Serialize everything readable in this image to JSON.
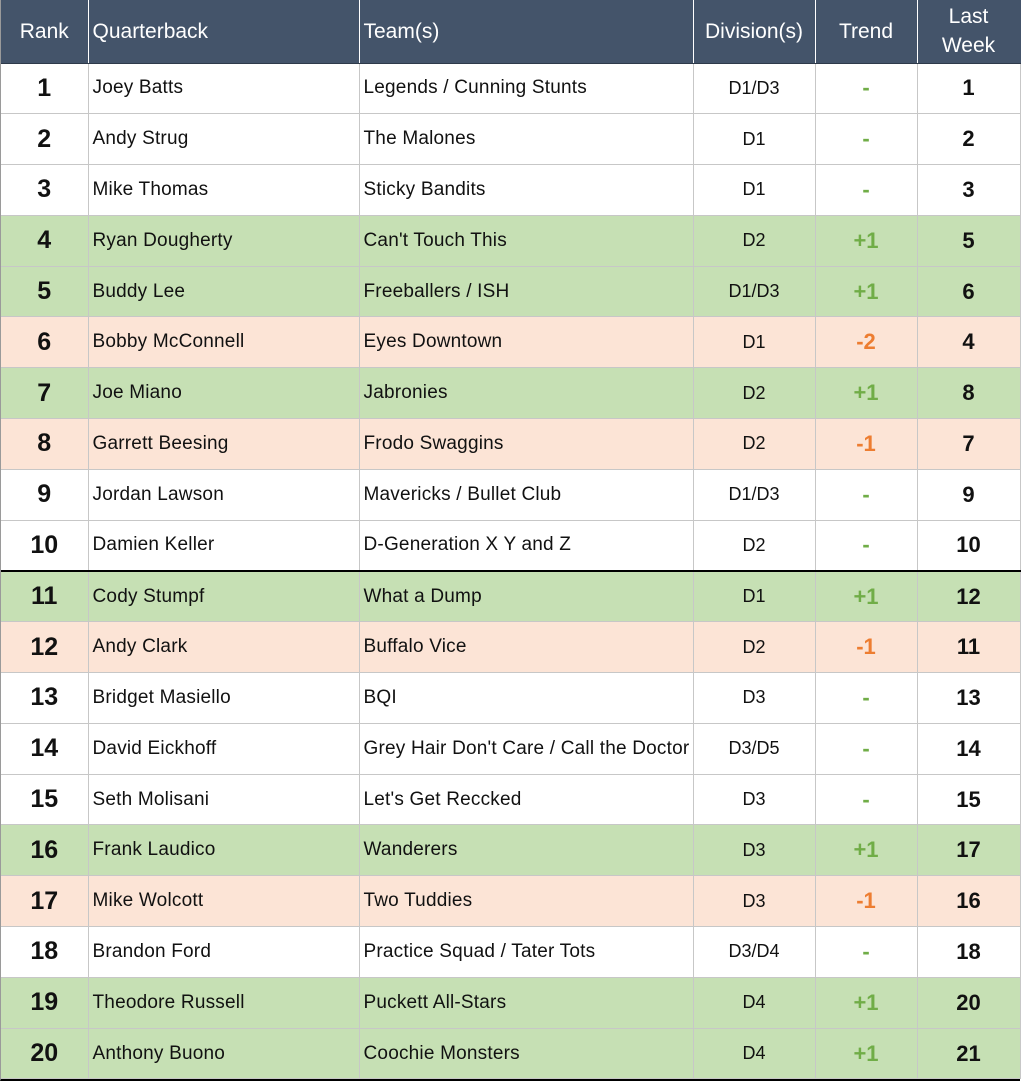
{
  "headers": {
    "rank": "Rank",
    "quarterback": "Quarterback",
    "teams": "Team(s)",
    "divisions": "Division(s)",
    "trend": "Trend",
    "last_week": "Last Week"
  },
  "colors": {
    "header_bg": "#44546a",
    "up_row": "#c6e0b4",
    "down_row": "#fce4d6",
    "up_trend": "#70ad47",
    "down_trend": "#ed7d31"
  },
  "rows": [
    {
      "rank": "1",
      "qb": "Joey Batts",
      "team": "Legends / Cunning Stunts",
      "div": "D1/D3",
      "trend": "-",
      "last": "1"
    },
    {
      "rank": "2",
      "qb": "Andy Strug",
      "team": "The Malones",
      "div": "D1",
      "trend": "-",
      "last": "2"
    },
    {
      "rank": "3",
      "qb": "Mike Thomas",
      "team": "Sticky Bandits",
      "div": "D1",
      "trend": "-",
      "last": "3"
    },
    {
      "rank": "4",
      "qb": "Ryan Dougherty",
      "team": "Can't Touch This",
      "div": "D2",
      "trend": "+1",
      "last": "5"
    },
    {
      "rank": "5",
      "qb": "Buddy Lee",
      "team": "Freeballers / ISH",
      "div": "D1/D3",
      "trend": "+1",
      "last": "6"
    },
    {
      "rank": "6",
      "qb": "Bobby McConnell",
      "team": "Eyes Downtown",
      "div": "D1",
      "trend": "-2",
      "last": "4"
    },
    {
      "rank": "7",
      "qb": "Joe Miano",
      "team": "Jabronies",
      "div": "D2",
      "trend": "+1",
      "last": "8"
    },
    {
      "rank": "8",
      "qb": "Garrett Beesing",
      "team": "Frodo Swaggins",
      "div": "D2",
      "trend": "-1",
      "last": "7"
    },
    {
      "rank": "9",
      "qb": "Jordan Lawson",
      "team": "Mavericks / Bullet Club",
      "div": "D1/D3",
      "trend": "-",
      "last": "9"
    },
    {
      "rank": "10",
      "qb": "Damien Keller",
      "team": "D-Generation X Y and Z",
      "div": "D2",
      "trend": "-",
      "last": "10"
    },
    {
      "rank": "11",
      "qb": "Cody Stumpf",
      "team": "What a Dump",
      "div": "D1",
      "trend": "+1",
      "last": "12"
    },
    {
      "rank": "12",
      "qb": "Andy Clark",
      "team": "Buffalo Vice",
      "div": "D2",
      "trend": "-1",
      "last": "11"
    },
    {
      "rank": "13",
      "qb": "Bridget Masiello",
      "team": "BQI",
      "div": "D3",
      "trend": "-",
      "last": "13"
    },
    {
      "rank": "14",
      "qb": "David Eickhoff",
      "team": "Grey Hair Don't Care / Call the Doctor",
      "div": "D3/D5",
      "trend": "-",
      "last": "14"
    },
    {
      "rank": "15",
      "qb": "Seth Molisani",
      "team": "Let's Get Reccked",
      "div": "D3",
      "trend": "-",
      "last": "15"
    },
    {
      "rank": "16",
      "qb": "Frank Laudico",
      "team": "Wanderers",
      "div": "D3",
      "trend": "+1",
      "last": "17"
    },
    {
      "rank": "17",
      "qb": "Mike Wolcott",
      "team": "Two Tuddies",
      "div": "D3",
      "trend": "-1",
      "last": "16"
    },
    {
      "rank": "18",
      "qb": "Brandon Ford",
      "team": "Practice Squad / Tater Tots",
      "div": "D3/D4",
      "trend": "-",
      "last": "18"
    },
    {
      "rank": "19",
      "qb": "Theodore Russell",
      "team": "Puckett All-Stars",
      "div": "D4",
      "trend": "+1",
      "last": "20"
    },
    {
      "rank": "20",
      "qb": "Anthony Buono",
      "team": "Coochie Monsters",
      "div": "D4",
      "trend": "+1",
      "last": "21"
    }
  ]
}
